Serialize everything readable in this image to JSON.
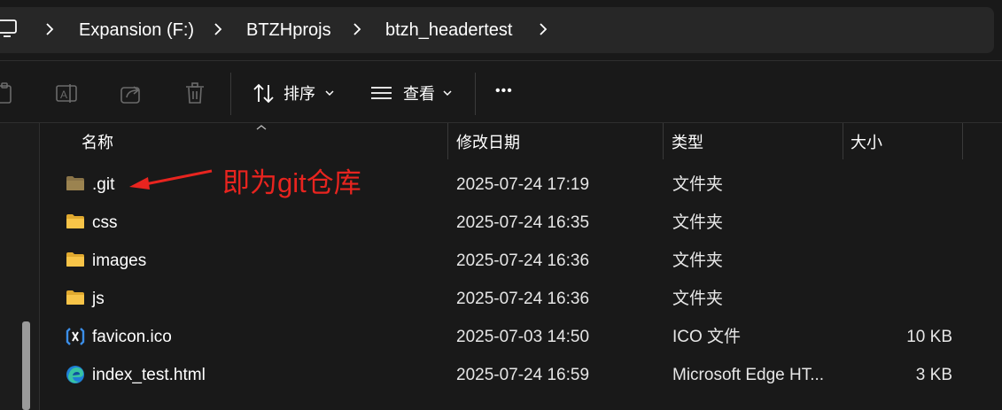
{
  "breadcrumb": {
    "items": [
      "Expansion (F:)",
      "BTZHprojs",
      "btzh_headertest"
    ]
  },
  "toolbar": {
    "sort_label": "排序",
    "view_label": "查看",
    "more_label": "•••"
  },
  "columns": {
    "name": "名称",
    "modified": "修改日期",
    "type": "类型",
    "size": "大小"
  },
  "files": [
    {
      "name": ".git",
      "modified": "2025-07-24 17:19",
      "type": "文件夹",
      "size": "",
      "icon": "folder-git-icon"
    },
    {
      "name": "css",
      "modified": "2025-07-24 16:35",
      "type": "文件夹",
      "size": "",
      "icon": "folder-icon"
    },
    {
      "name": "images",
      "modified": "2025-07-24 16:36",
      "type": "文件夹",
      "size": "",
      "icon": "folder-icon"
    },
    {
      "name": "js",
      "modified": "2025-07-24 16:36",
      "type": "文件夹",
      "size": "",
      "icon": "folder-icon"
    },
    {
      "name": "favicon.ico",
      "modified": "2025-07-03 14:50",
      "type": "ICO 文件",
      "size": "10 KB",
      "icon": "ico-file-icon"
    },
    {
      "name": "index_test.html",
      "modified": "2025-07-24 16:59",
      "type": "Microsoft Edge HT...",
      "size": "3 KB",
      "icon": "edge-html-icon"
    }
  ],
  "annotation": {
    "text": "即为git仓库",
    "color": "#e8241f"
  },
  "colors": {
    "background": "#191919",
    "folder": "#f7c448",
    "folder_dim": "#8a7448"
  }
}
